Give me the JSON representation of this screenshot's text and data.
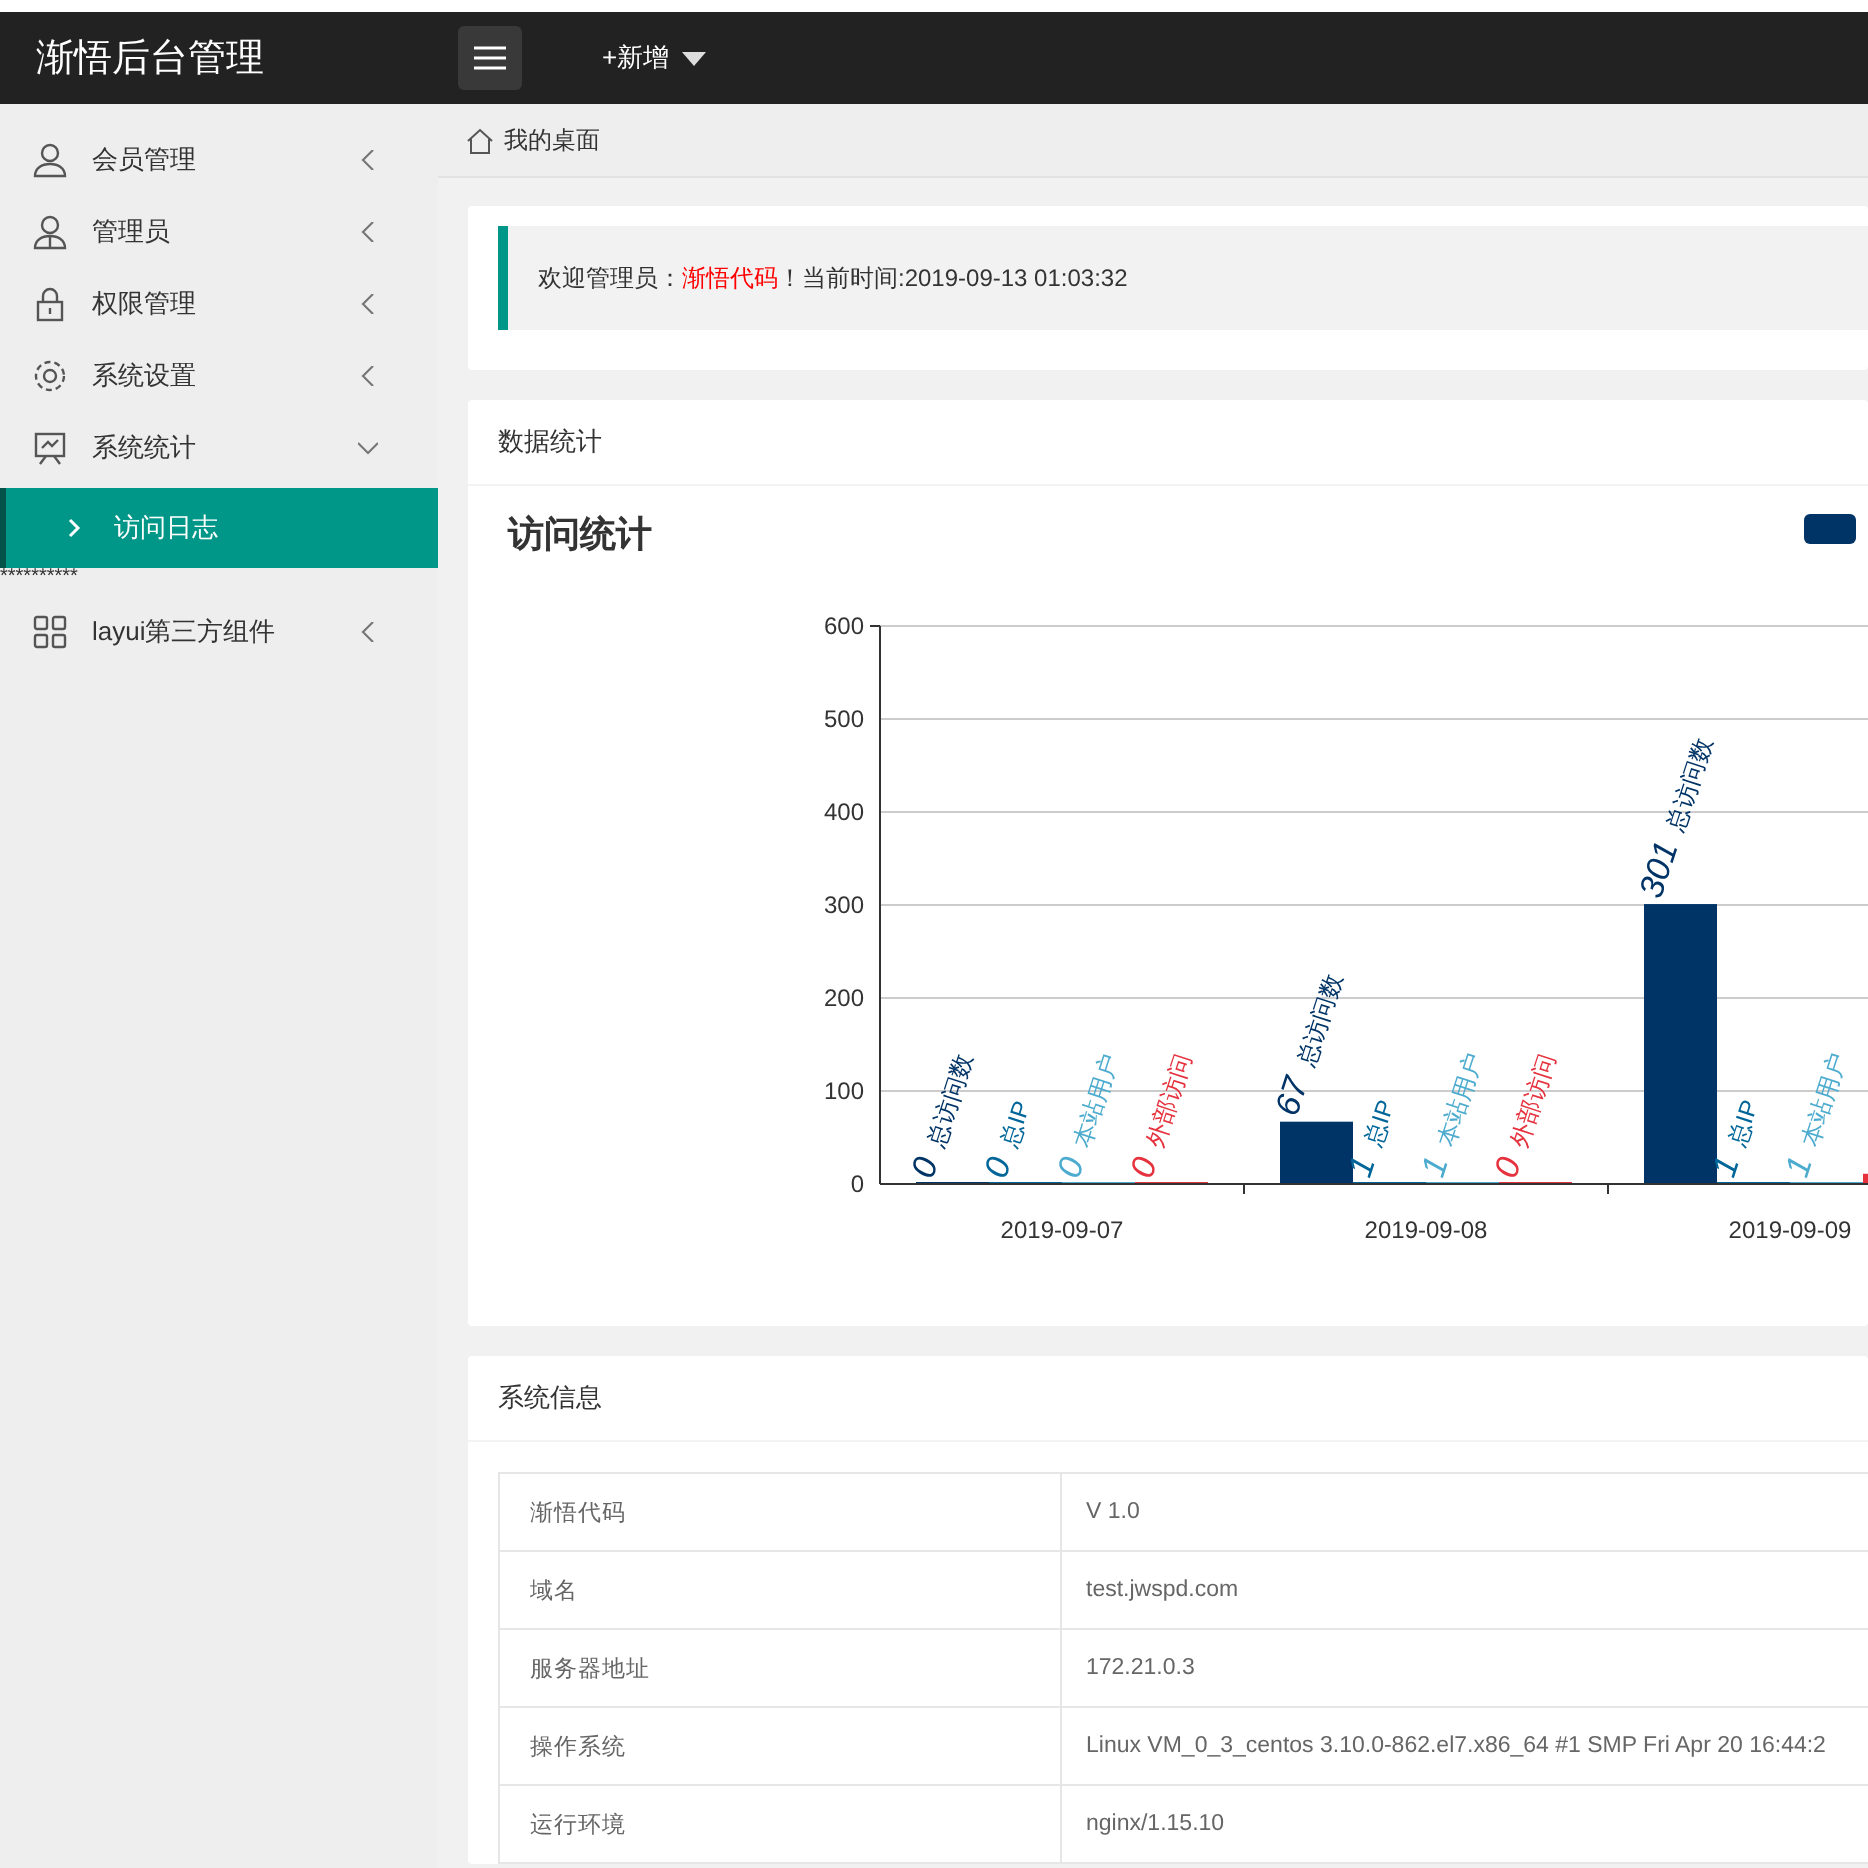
{
  "header": {
    "title": "渐悟后台管理",
    "add_menu": "+新增"
  },
  "sidebar": {
    "items": [
      {
        "kind": "menu",
        "label": "会员管理",
        "expanded": false,
        "selected": false
      },
      {
        "kind": "menu",
        "label": "管理员",
        "expanded": false,
        "selected": false
      },
      {
        "kind": "menu",
        "label": "权限管理",
        "expanded": false,
        "selected": false
      },
      {
        "kind": "menu",
        "label": "系统设置",
        "expanded": false,
        "selected": false
      },
      {
        "kind": "menu",
        "label": "系统统计",
        "expanded": true,
        "selected": false,
        "children": [
          {
            "label": "访问日志",
            "selected": true
          }
        ]
      },
      {
        "kind": "text",
        "label": "**********"
      },
      {
        "kind": "menu",
        "label": "layui第三方组件",
        "expanded": false,
        "selected": false
      }
    ]
  },
  "breadcrumb": "我的桌面",
  "welcome": {
    "prefix": "欢迎管理员：",
    "name": "渐悟代码",
    "suffix": "！当前时间:2019-09-13 01:03:32"
  },
  "stats_card": {
    "title": "数据统计",
    "chart_title": "访问统计",
    "chart_data": {
      "type": "bar",
      "categories": [
        "2019-09-07",
        "2019-09-08",
        "2019-09-09"
      ],
      "ylim": [
        0,
        600
      ],
      "yticks": [
        0,
        100,
        200,
        300,
        400,
        500,
        600
      ],
      "grid": true,
      "data_labels": "value_labels",
      "series": [
        {
          "name": "总访问数",
          "color": "#003366",
          "values": [
            0,
            67,
            301
          ],
          "value_labels": [
            "0",
            "67",
            "301"
          ]
        },
        {
          "name": "总IP",
          "color": "#006699",
          "values": [
            0,
            1,
            1
          ],
          "value_labels": [
            "0",
            "1",
            "1"
          ]
        },
        {
          "name": "本站用户",
          "color": "#4cabce",
          "values": [
            0,
            1,
            1
          ],
          "value_labels": [
            "0",
            "1",
            "1"
          ]
        },
        {
          "name": "外部访问",
          "color": "#e5323e",
          "values": [
            0,
            0,
            11
          ],
          "value_labels": [
            "0",
            "0",
            null
          ]
        }
      ]
    }
  },
  "system_info": {
    "title": "系统信息",
    "rows": [
      {
        "key": "渐悟代码",
        "value": "V 1.0"
      },
      {
        "key": "域名",
        "value": "test.jwspd.com"
      },
      {
        "key": "服务器地址",
        "value": "172.21.0.3"
      },
      {
        "key": "操作系统",
        "value": "Linux VM_0_3_centos 3.10.0-862.el7.x86_64 #1 SMP Fri Apr 20 16:44:2"
      },
      {
        "key": "运行环境",
        "value": "nginx/1.15.10"
      }
    ]
  }
}
